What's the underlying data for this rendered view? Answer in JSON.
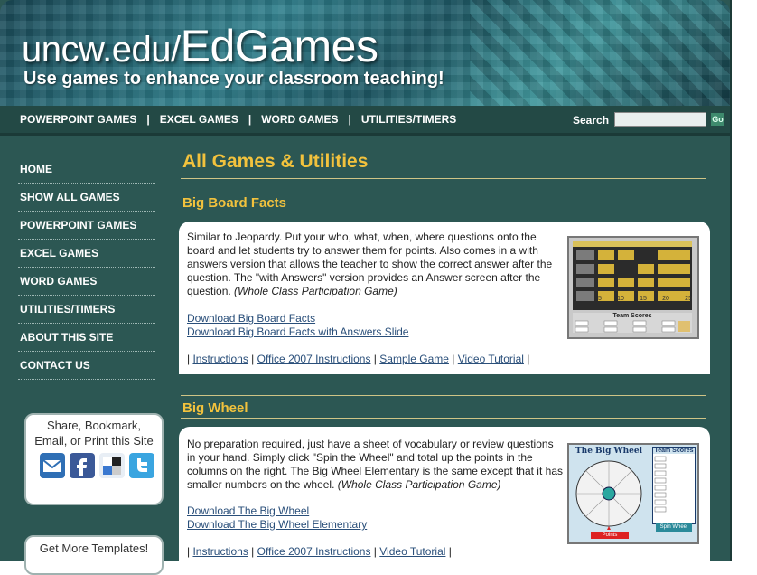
{
  "header": {
    "site_title_prefix": "uncw.edu/",
    "site_title_main": "EdGames",
    "tagline": "Use games to enhance your classroom teaching!"
  },
  "topnav": {
    "items": [
      "POWERPOINT GAMES",
      "EXCEL GAMES",
      "WORD GAMES",
      "UTILITIES/TIMERS"
    ],
    "separator": "|",
    "search_label": "Search",
    "search_value": "",
    "go_label": "Go"
  },
  "sidebar": {
    "items": [
      "HOME",
      "SHOW ALL GAMES",
      "POWERPOINT GAMES",
      "EXCEL GAMES",
      "WORD GAMES",
      "UTILITIES/TIMERS",
      "ABOUT THIS SITE",
      "CONTACT US"
    ],
    "share": {
      "line1": "Share, Bookmark,",
      "line2": "Email, or Print this Site",
      "icons": [
        "email-icon",
        "facebook-icon",
        "delicious-icon",
        "twitter-icon"
      ],
      "icon_colors": [
        "#2f6fb5",
        "#3b5998",
        "#3a78d0",
        "#3aa5e0"
      ]
    },
    "more_templates": "Get More Templates!"
  },
  "main": {
    "page_title": "All Games & Utilities",
    "sections": [
      {
        "title": "Big Board Facts",
        "description": "Similar to Jeopardy. Put your who, what, when, where questions onto the board and let students try to answer them for points. Also comes in a with answers version that allows the teacher to show the correct answer after the question. The \"with Answers\" version provides an Answer screen after the question.",
        "note": "(Whole Class Participation Game)",
        "downloads": [
          "Download Big Board Facts",
          "Download Big Board Facts with Answers Slide"
        ],
        "links": [
          "Instructions",
          "Office 2007 Instructions",
          "Sample Game",
          "Video Tutorial"
        ],
        "thumb": {
          "board_values": [
            "5",
            "10",
            "15",
            "20",
            "25"
          ],
          "scores_title": "Team Scores"
        }
      },
      {
        "title": "Big Wheel",
        "description": "No preparation required, just have a sheet of vocabulary or review questions in your hand. Simply click \"Spin the Wheel\" and total up the points in the columns on the right. The Big Wheel Elementary is the same except that it has smaller numbers on the wheel.",
        "note": "(Whole Class Participation Game)",
        "downloads": [
          "Download The Big Wheel ",
          "Download The Big Wheel Elementary"
        ],
        "links": [
          "Instructions",
          "Office 2007 Instructions",
          "Video Tutorial"
        ],
        "thumb": {
          "title": "The Big Wheel",
          "scores_title": "Team Scores",
          "points_label": "Points",
          "spin_label": "Spin Wheel"
        }
      }
    ]
  },
  "colors": {
    "background": "#2c5753",
    "heading": "#f2c23d",
    "link": "#2a4f7a"
  }
}
